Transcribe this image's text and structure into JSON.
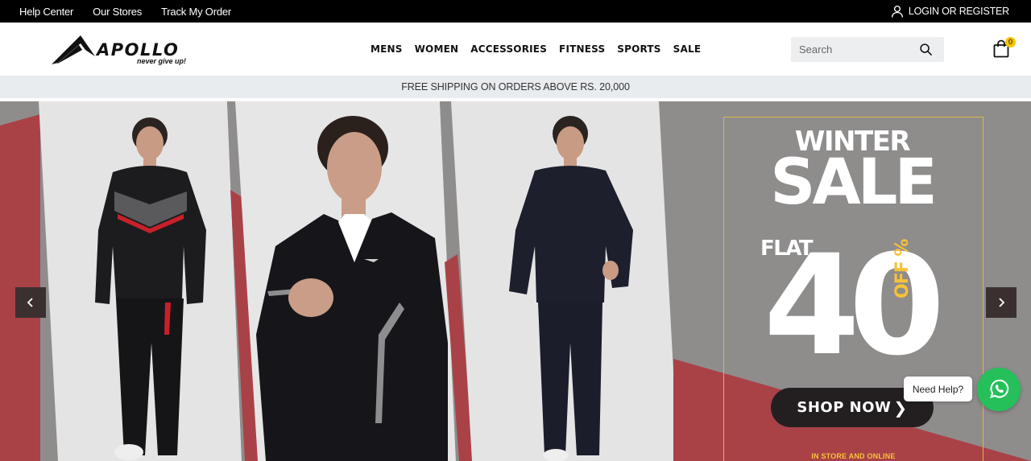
{
  "topbar": {
    "links": [
      "Help Center",
      "Our Stores",
      "Track My Order"
    ],
    "login_label": "LOGIN OR REGISTER"
  },
  "header": {
    "logo": {
      "brand": "APOLLO",
      "tagline": "never give up!"
    },
    "nav": [
      "MENS",
      "WOMEN",
      "ACCESSORIES",
      "FITNESS",
      "SPORTS",
      "SALE"
    ],
    "search": {
      "placeholder": "Search",
      "value": ""
    },
    "cart_count": "0"
  },
  "announcement": "FREE SHIPPING ON ORDERS ABOVE RS. 20,000",
  "hero": {
    "promo": {
      "line1": "WINTER",
      "line2": "SALE",
      "flat": "FLAT",
      "discount": "40",
      "off": "OFF %",
      "cta": "SHOP NOW",
      "footnote": "IN STORE AND ONLINE"
    },
    "colors": {
      "red": "#a94247",
      "gray": "#8f8c8c",
      "light": "#e3e3e4",
      "accent_gold": "#d7b84a",
      "accent_yellow": "#f6c23a"
    }
  },
  "help_widget": {
    "label": "Need Help?",
    "icon": "whatsapp-icon",
    "color": "#25c05a"
  }
}
